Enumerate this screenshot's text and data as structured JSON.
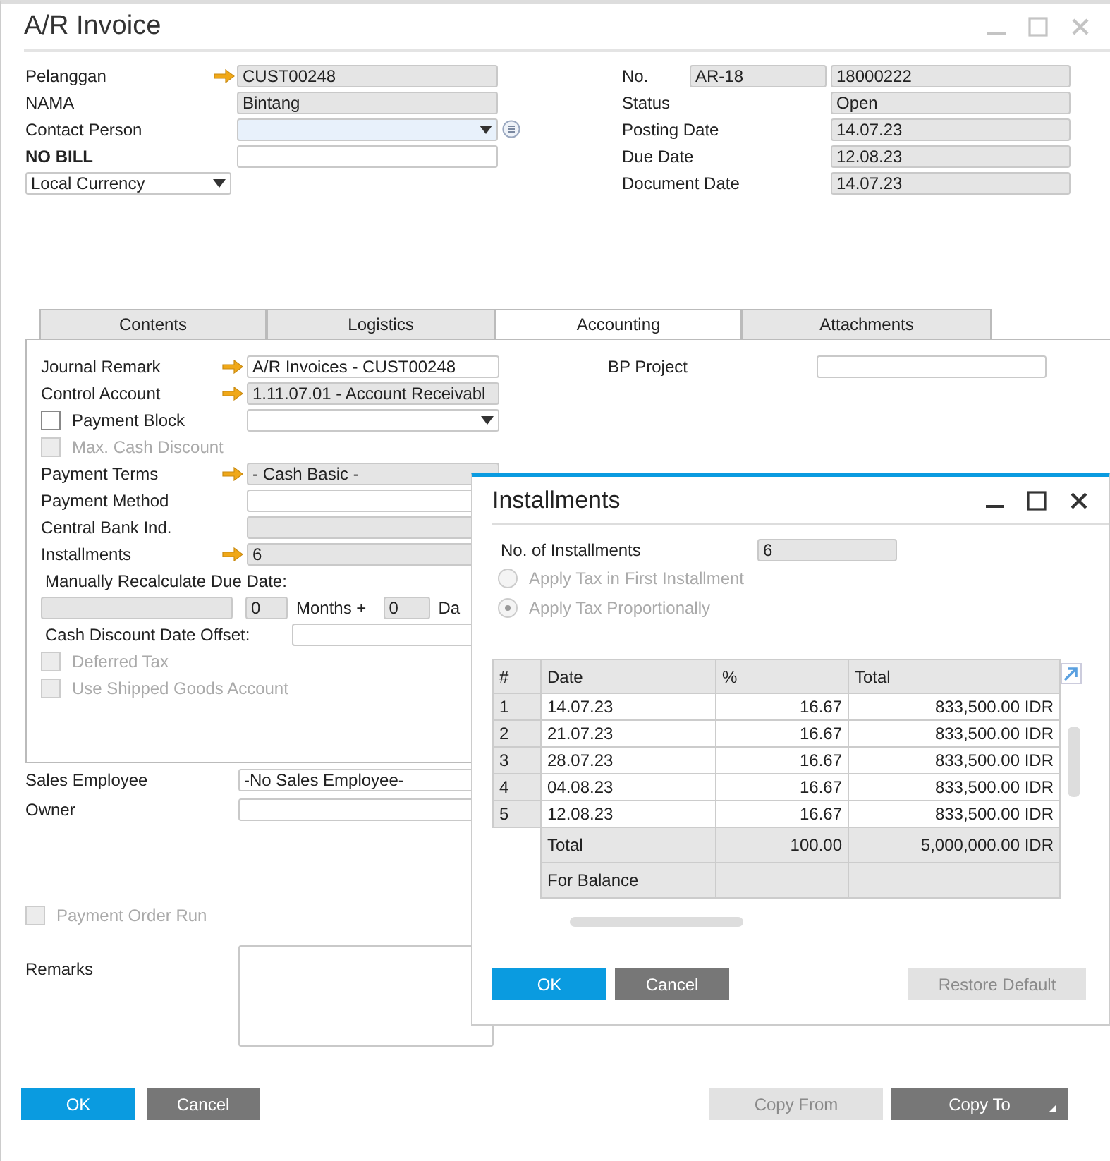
{
  "window": {
    "title": "A/R Invoice"
  },
  "header_left": [
    {
      "label": "Pelanggan",
      "bold": false,
      "arrow": true,
      "kind": "readonly",
      "value": "CUST00248",
      "focused": false
    },
    {
      "label": "NAMA",
      "bold": false,
      "arrow": false,
      "kind": "readonly",
      "value": "Bintang",
      "focused": false
    },
    {
      "label": "Contact Person",
      "bold": false,
      "arrow": false,
      "kind": "dropdown",
      "focused": true
    },
    {
      "label": "NO BILL",
      "bold": true,
      "arrow": false,
      "kind": "input",
      "focused": false
    }
  ],
  "currency": {
    "value": "Local Currency"
  },
  "header_right": [
    {
      "label": "No.",
      "series": "AR-18",
      "value": "18000222"
    },
    {
      "label": "Status",
      "value": "Open"
    },
    {
      "label": "Posting Date",
      "value": "14.07.23"
    },
    {
      "label": "Due Date",
      "value": "12.08.23"
    },
    {
      "label": "Document Date",
      "value": "14.07.23"
    }
  ],
  "tabs": [
    {
      "label": "Contents",
      "selected": false
    },
    {
      "label": "Logistics",
      "selected": false
    },
    {
      "label": "Accounting",
      "selected": true
    },
    {
      "label": "Attachments",
      "selected": false
    }
  ],
  "accounting": {
    "rows": [
      {
        "kind": "field",
        "label": "Journal Remark",
        "arrow": true,
        "readonly": false,
        "value": "A/R Invoices - CUST00248"
      },
      {
        "kind": "field",
        "label": "Control Account",
        "arrow": true,
        "readonly": true,
        "value": "1.11.07.01 - Account Receivabl"
      },
      {
        "kind": "check",
        "label": "Payment Block",
        "checked": false,
        "disabled": false,
        "dropdown": true
      },
      {
        "kind": "check",
        "label": "Max. Cash Discount",
        "checked": false,
        "disabled": true
      },
      {
        "kind": "field",
        "label": "Payment Terms",
        "arrow": true,
        "readonly": true,
        "value": "- Cash Basic -"
      },
      {
        "kind": "field",
        "label": "Payment Method",
        "arrow": false,
        "readonly": false
      },
      {
        "kind": "field",
        "label": "Central Bank Ind.",
        "arrow": false,
        "readonly": true
      },
      {
        "kind": "field",
        "label": "Installments",
        "arrow": true,
        "readonly": true,
        "value": "6"
      },
      {
        "kind": "heading",
        "label": "Manually Recalculate Due Date:"
      },
      {
        "kind": "recalc",
        "months": "0",
        "months_label": "Months +",
        "days": "0",
        "days_label": "Da"
      },
      {
        "kind": "offset",
        "label": "Cash Discount Date Offset:"
      },
      {
        "kind": "check",
        "label": "Deferred Tax",
        "checked": false,
        "disabled": true
      },
      {
        "kind": "check",
        "label": "Use Shipped Goods Account",
        "checked": false,
        "disabled": true
      }
    ],
    "bp_project": {
      "label": "BP Project"
    }
  },
  "sales_employee": {
    "label": "Sales Employee",
    "value": "-No Sales Employee-"
  },
  "owner": {
    "label": "Owner"
  },
  "payment_order_run": {
    "label": "Payment Order Run",
    "checked": false,
    "disabled": true
  },
  "remarks": {
    "label": "Remarks"
  },
  "buttons": [
    {
      "label": "OK",
      "kind": "primary"
    },
    {
      "label": "Cancel",
      "kind": "secondary"
    },
    {
      "label": "Copy From",
      "kind": "disabled"
    },
    {
      "label": "Copy To",
      "kind": "menu"
    }
  ],
  "installments_dialog": {
    "title": "Installments",
    "count": {
      "label": "No. of Installments",
      "value": "6"
    },
    "options": [
      {
        "label": "Apply Tax in First Installment",
        "selected": false,
        "disabled": true
      },
      {
        "label": "Apply Tax Proportionally",
        "selected": true,
        "disabled": true
      }
    ],
    "columns": [
      "#",
      "Date",
      "%",
      "Total"
    ],
    "rows": [
      [
        "1",
        "14.07.23",
        "16.67",
        "833,500.00 IDR"
      ],
      [
        "2",
        "21.07.23",
        "16.67",
        "833,500.00 IDR"
      ],
      [
        "3",
        "28.07.23",
        "16.67",
        "833,500.00 IDR"
      ],
      [
        "4",
        "04.08.23",
        "16.67",
        "833,500.00 IDR"
      ],
      [
        "5",
        "12.08.23",
        "16.67",
        "833,500.00 IDR"
      ]
    ],
    "summary": [
      {
        "label": "Total",
        "percent": "100.00",
        "total": "5,000,000.00 IDR"
      },
      {
        "label": "For Balance"
      }
    ],
    "buttons": [
      {
        "label": "OK",
        "kind": "primary"
      },
      {
        "label": "Cancel",
        "kind": "secondary"
      },
      {
        "label": "Restore Default",
        "kind": "disabled"
      }
    ]
  }
}
